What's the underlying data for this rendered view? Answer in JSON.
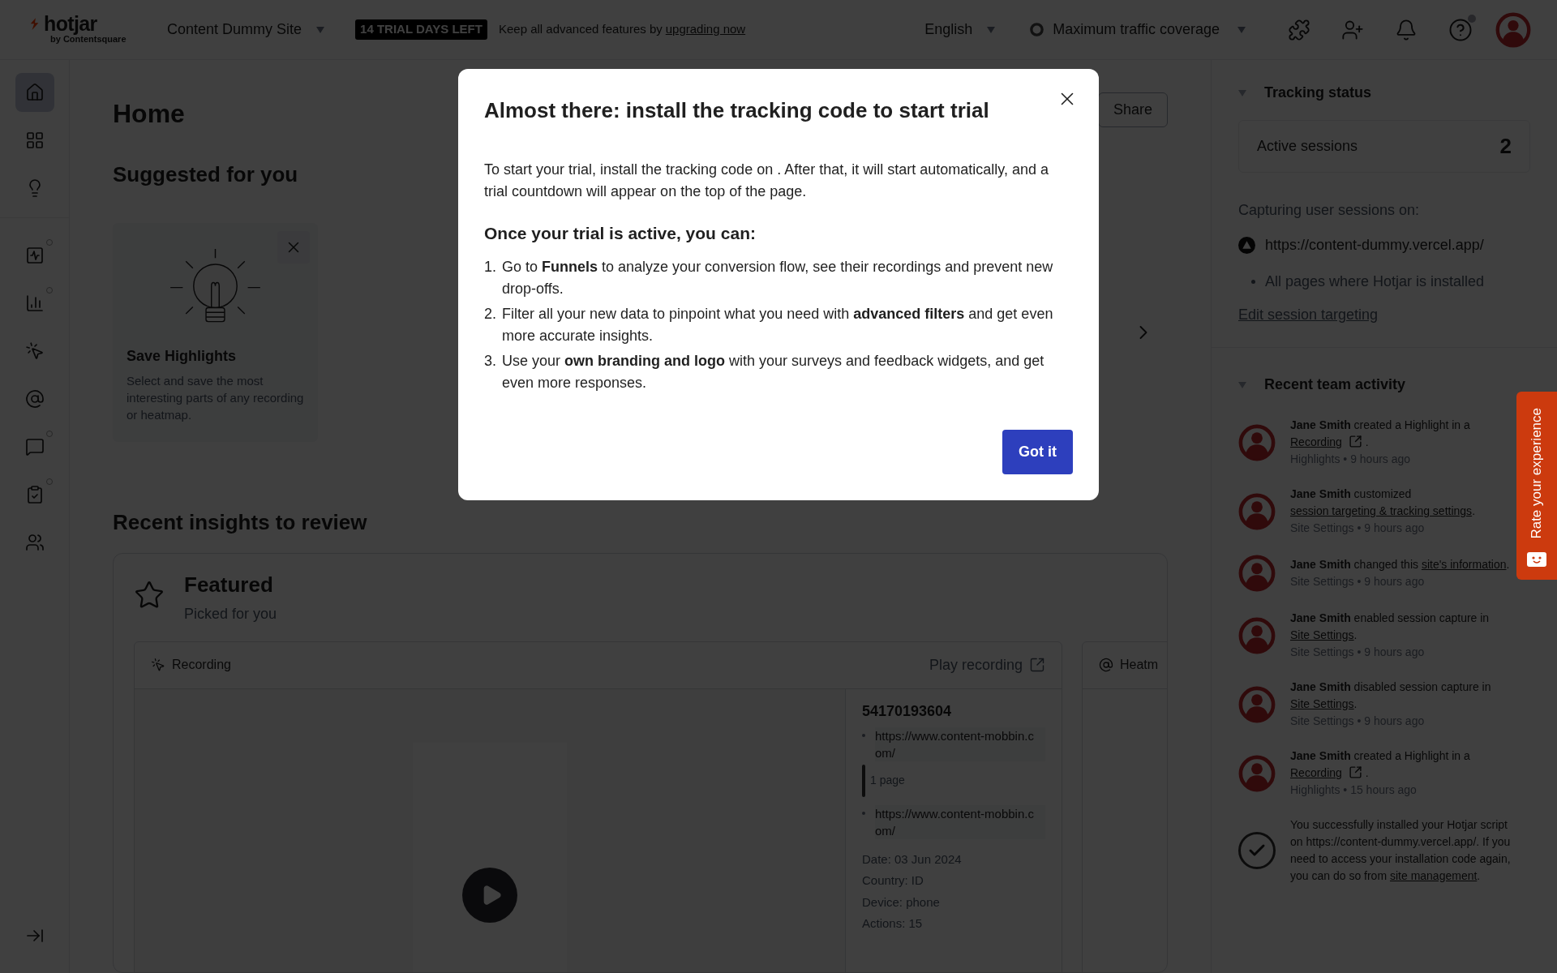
{
  "header": {
    "logo": "hotjar",
    "logo_sub": "by Contentsquare",
    "site": "Content Dummy Site",
    "trial_badge": "14 TRIAL DAYS LEFT",
    "upgrade_text": "Keep all advanced features by",
    "upgrade_link": "upgrading now",
    "language": "English",
    "coverage": "Maximum traffic coverage",
    "help_dot": true
  },
  "sidebar": {
    "groups": [
      [
        {
          "selected": true,
          "dot": false
        },
        {
          "selected": false,
          "dot": false
        },
        {
          "selected": false,
          "dot": false
        }
      ],
      [
        {
          "selected": false,
          "dot": true
        },
        {
          "selected": false,
          "dot": true
        },
        {
          "selected": false,
          "dot": false
        },
        {
          "selected": false,
          "dot": false
        },
        {
          "selected": false,
          "dot": true
        },
        {
          "selected": false,
          "dot": true
        },
        {
          "selected": false,
          "dot": false
        }
      ]
    ]
  },
  "main": {
    "title": "Home",
    "share": "Share",
    "suggested_title": "Suggested for you",
    "suggestion": {
      "title": "Save Highlights",
      "text": "Select and save the most interesting parts of any recording or heatmap."
    },
    "insights_title": "Recent insights to review",
    "featured": {
      "title": "Featured",
      "subtitle": "Picked for you",
      "recording": {
        "label": "Recording",
        "play": "Play recording",
        "id": "54170193604",
        "pages": [
          "https://www.content-mobbin.com/",
          "https://www.content-mobbin.com/"
        ],
        "page_count": "1 page",
        "meta": [
          "Date: 03 Jun 2024",
          "Country: ID",
          "Device: phone",
          "Actions: 15"
        ]
      },
      "heatmap": {
        "label": "Heatm"
      }
    }
  },
  "tracking": {
    "title": "Tracking status",
    "expanded": true,
    "sessions_label": "Active sessions",
    "sessions_value": "2",
    "capturing": "Capturing user sessions on:",
    "url": "https://content-dummy.vercel.app/",
    "scope": "All pages where Hotjar is installed",
    "edit_link": "Edit session targeting"
  },
  "activity": {
    "title": "Recent team activity",
    "expanded": true,
    "items": [
      {
        "kind": "user",
        "actor": "Jane Smith",
        "action": "created a Highlight in a",
        "link": "Recording",
        "external": true,
        "end": " .",
        "meta": "Highlights • 9 hours ago"
      },
      {
        "kind": "user",
        "actor": "Jane Smith",
        "action": "customized",
        "link": "session targeting & tracking settings",
        "external": false,
        "end": ".",
        "meta": "Site Settings • 9 hours ago"
      },
      {
        "kind": "user",
        "actor": "Jane Smith",
        "action": "changed this",
        "link": "site's information",
        "external": false,
        "end": ".",
        "meta": "Site Settings • 9 hours ago"
      },
      {
        "kind": "user",
        "actor": "Jane Smith",
        "action": "enabled session capture in",
        "link": "Site Settings",
        "external": false,
        "end": ".",
        "meta": "Site Settings • 9 hours ago"
      },
      {
        "kind": "user",
        "actor": "Jane Smith",
        "action": "disabled session capture in",
        "link": "Site Settings",
        "external": false,
        "end": ".",
        "meta": "Site Settings • 9 hours ago"
      },
      {
        "kind": "user",
        "actor": "Jane Smith",
        "action": "created a Highlight in a",
        "link": "Recording",
        "external": true,
        "end": " .",
        "meta": "Highlights • 15 hours ago"
      },
      {
        "kind": "success",
        "action": "You successfully installed your Hotjar script on https://content-dummy.vercel.app/. If you need to access your installation code again, you can do so from",
        "link": "site management",
        "external": false,
        "end": "."
      }
    ]
  },
  "feedback_tab": {
    "label": "Rate your experience"
  },
  "modal": {
    "title": "Almost there: install the tracking code to start trial",
    "intro": "To start your trial, install the tracking code on . After that, it will start automatically, and a trial countdown will appear on the top of the page.",
    "subtitle": "Once your trial is active, you can:",
    "steps": [
      {
        "number": "1.",
        "text": "Go to **Funnels** to analyze your conversion flow, see their recordings and prevent new drop-offs."
      },
      {
        "number": "2.",
        "text": "Filter all your new data to pinpoint what you need with **advanced filters** and get even more accurate insights."
      },
      {
        "number": "3.",
        "text": "Use your **own branding and logo** with your surveys and feedback widgets, and get even more responses."
      }
    ],
    "button": "Got it"
  }
}
